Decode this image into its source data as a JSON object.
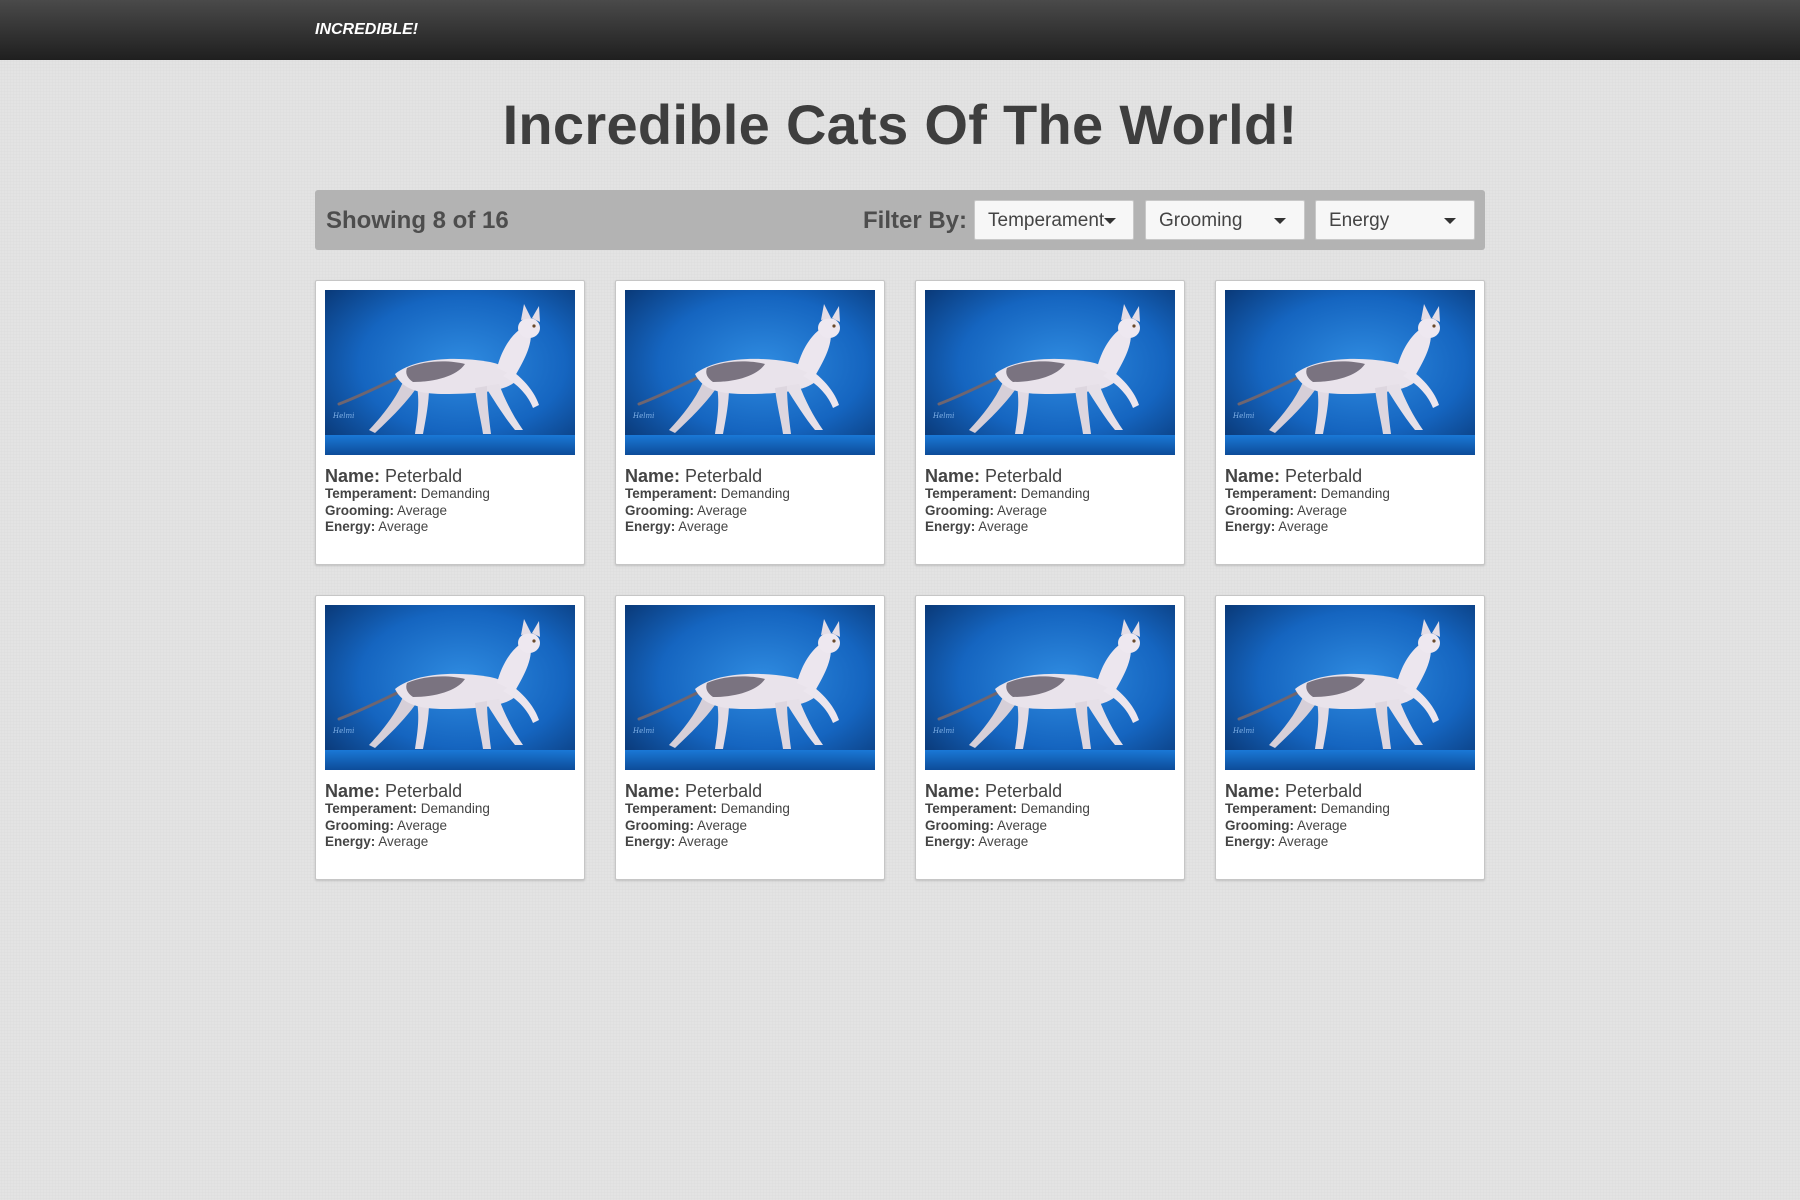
{
  "nav": {
    "brand": "INCREDIBLE!"
  },
  "page": {
    "title": "Incredible Cats Of The World!"
  },
  "filterbar": {
    "showing": "Showing 8 of 16",
    "filter_label": "Filter By:",
    "dropdowns": [
      {
        "label": "Temperament"
      },
      {
        "label": "Grooming"
      },
      {
        "label": "Energy"
      }
    ]
  },
  "labels": {
    "name": "Name:",
    "temperament": "Temperament:",
    "grooming": "Grooming:",
    "energy": "Energy:"
  },
  "cats": [
    {
      "name": "Peterbald",
      "temperament": "Demanding",
      "grooming": "Average",
      "energy": "Average",
      "signature": "Helmi"
    },
    {
      "name": "Peterbald",
      "temperament": "Demanding",
      "grooming": "Average",
      "energy": "Average",
      "signature": "Helmi"
    },
    {
      "name": "Peterbald",
      "temperament": "Demanding",
      "grooming": "Average",
      "energy": "Average",
      "signature": "Helmi"
    },
    {
      "name": "Peterbald",
      "temperament": "Demanding",
      "grooming": "Average",
      "energy": "Average",
      "signature": "Helmi"
    },
    {
      "name": "Peterbald",
      "temperament": "Demanding",
      "grooming": "Average",
      "energy": "Average",
      "signature": "Helmi"
    },
    {
      "name": "Peterbald",
      "temperament": "Demanding",
      "grooming": "Average",
      "energy": "Average",
      "signature": "Helmi"
    },
    {
      "name": "Peterbald",
      "temperament": "Demanding",
      "grooming": "Average",
      "energy": "Average",
      "signature": "Helmi"
    },
    {
      "name": "Peterbald",
      "temperament": "Demanding",
      "grooming": "Average",
      "energy": "Average",
      "signature": "Helmi"
    }
  ],
  "colors": {
    "navbar": "#2b2b2b",
    "filterbar": "#b3b3b3",
    "photo_background": "#0b4f9e"
  }
}
